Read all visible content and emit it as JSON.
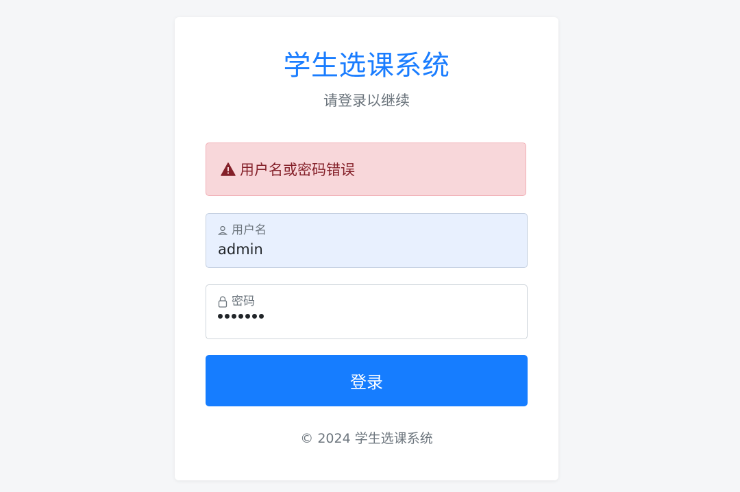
{
  "app": {
    "title": "学生选课系统",
    "subtitle": "请登录以继续"
  },
  "alert": {
    "message": "用户名或密码错误",
    "icon": "warning-triangle-icon",
    "color": "#842029",
    "background": "#f8d7da"
  },
  "form": {
    "username": {
      "label": "用户名",
      "value": "admin",
      "icon": "user-icon"
    },
    "password": {
      "label": "密码",
      "masked_length": 7,
      "icon": "lock-icon"
    },
    "submit_label": "登录"
  },
  "footer": {
    "text": "© 2024 学生选课系统"
  },
  "colors": {
    "accent": "#167dff",
    "page_background": "#f5f6f8"
  }
}
